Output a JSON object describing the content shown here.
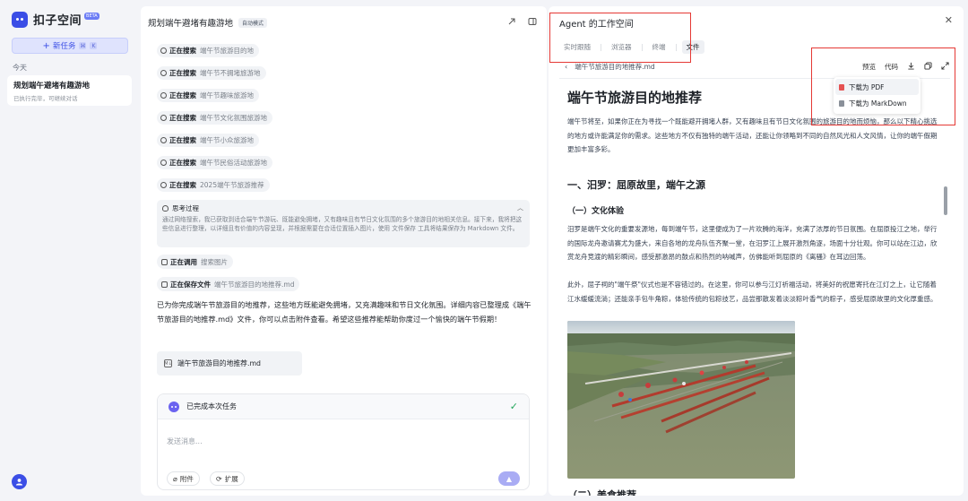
{
  "sidebar": {
    "logo_text": "扣子空间",
    "beta": "BETA",
    "new_task_label": "新任务",
    "section_today": "今天",
    "task": {
      "title": "规划端午避堵有趣游地",
      "subtitle": "已执行完毕，可继续对话"
    }
  },
  "chat": {
    "title": "规划端午避堵有趣游地",
    "mode_badge": "自动模式",
    "searches": [
      {
        "verb": "正在搜索",
        "query": "端午节旅游目的地"
      },
      {
        "verb": "正在搜索",
        "query": "端午节不拥堵旅游地"
      },
      {
        "verb": "正在搜索",
        "query": "端午节趣味旅游地"
      },
      {
        "verb": "正在搜索",
        "query": "端午节文化氛围旅游地"
      },
      {
        "verb": "正在搜索",
        "query": "端午节小众旅游地"
      },
      {
        "verb": "正在搜索",
        "query": "端午节民俗活动旅游地"
      },
      {
        "verb": "正在搜索",
        "query": "2025端午节旅游推荐"
      }
    ],
    "thinking": {
      "title": "思考过程",
      "body": "通过网络搜索，我已获取到适合端午节游玩、既能避免拥堵，又有趣味且有节日文化氛围的多个旅游目的地相关信息。接下来，我将把这些信息进行整理，以详细且有价值的内容呈现，并根据需要在合适位置插入图片，使用 文件保存 工具将结果保存为 Markdown 文件。"
    },
    "tool_call": {
      "verb": "正在调用",
      "target": "搜索图片"
    },
    "save_call": {
      "verb": "正在保存文件",
      "target": "端午节旅游目的地推荐.md"
    },
    "answer": "已为你完成端午节旅游目的地推荐，这些地方既能避免拥堵，又充满趣味和节日文化氛围。详细内容已整理成《端午节旅游目的地推荐.md》文件，你可以点击附件查看。希望这些推荐能帮助你度过一个愉快的端午节假期！",
    "file_name": "端午节旅游目的地推荐.md",
    "composer": {
      "status": "已完成本次任务",
      "placeholder": "发送消息...",
      "attach_label": "附件",
      "extend_label": "扩展"
    }
  },
  "workspace": {
    "title": "Agent 的工作空间",
    "tabs": [
      "实时跟随",
      "浏览器",
      "终端",
      "文件"
    ],
    "active_tab": "文件",
    "doc_path": "端午节旅游目的地推荐.md",
    "tools": {
      "preview": "预览",
      "code": "代码"
    },
    "download_menu": [
      "下载为 PDF",
      "下载为 MarkDown"
    ],
    "doc": {
      "h1": "端午节旅游目的地推荐",
      "intro": "端午节将至，如果你正在为寻找一个既能避开拥堵人群，又有趣味且有节日文化氛围的旅游目的地而烦恼，那么以下精心挑选的地方或许能满足你的需求。这些地方不仅有独特的端午活动，还能让你领略到不同的自然风光和人文风情，让你的端午假期更加丰富多彩。",
      "h2_1": "一、汨罗：屈原故里，端午之源",
      "h3_1": "（一）文化体验",
      "p1": "汨罗是端午文化的重要发源地，每到端午节，这里便成为了一片欢腾的海洋，充满了浓厚的节日氛围。在屈原投江之地，举行的国际龙舟邀请赛尤为盛大，来自各地的龙舟队伍齐聚一堂，在汨罗江上展开激烈角逐，场面十分壮观。你可以站在江边，欣赏龙舟竞渡的精彩瞬间，感受那激昂的鼓点和热烈的呐喊声，仿佛能听到屈原的《离骚》在耳边回荡。",
      "p2": "此外，屈子祠的\"端午祭\"仪式也是不容错过的。在这里，你可以参与江灯祈福活动，将美好的祝愿寄托在江灯之上，让它随着江水缓缓流淌；还能亲手包牛角粽，体验传统的包粽技艺，品尝那散发着淡淡粽叶香气的粽子，感受屈原故里的文化厚重感。",
      "h2_2": "（二）美食推荐"
    }
  }
}
